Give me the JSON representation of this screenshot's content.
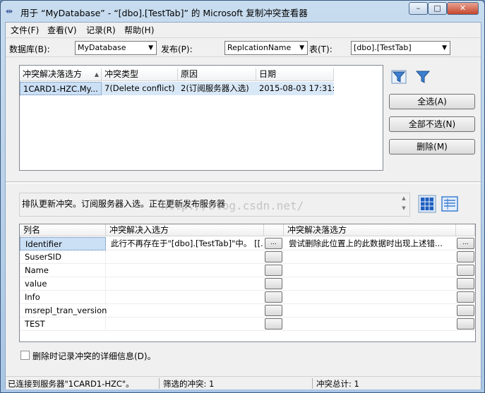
{
  "window": {
    "title": "用于 “MyDatabase” - “[dbo].[TestTab]” 的 Microsoft 复制冲突查看器",
    "minimize": "–",
    "maximize": "□",
    "close": "✕"
  },
  "menu": [
    "文件(F)",
    "查看(V)",
    "记录(R)",
    "帮助(H)"
  ],
  "toolbar": {
    "database_label": "数据库(B):",
    "database_value": "MyDatabase",
    "publication_label": "发布(P):",
    "publication_value": "ReplcationName",
    "table_label": "表(T):",
    "table_value": "[dbo].[TestTab]"
  },
  "conflict_list": {
    "columns": [
      "冲突解决落选方",
      "冲突类型",
      "原因",
      "日期"
    ],
    "rows": [
      [
        "1CARD1-HZC.My...",
        "7(Delete conflict)",
        "2(订阅服务器入选)",
        "2015-08-03 17:31:..."
      ]
    ]
  },
  "actions": {
    "select_all": "全选(A)",
    "select_none": "全部不选(N)",
    "delete": "删除(M)"
  },
  "message": "排队更新冲突。订阅服务器入选。正在更新发布服务器",
  "watermark": "http://blog.csdn.net/",
  "detail_grid": {
    "columns": [
      "列名",
      "冲突解决入选方",
      "冲突解决落选方"
    ],
    "rows": [
      {
        "name": "Identifier",
        "winner": "此行不再存在于\"[dbo].[TestTab]\"中。 [[...",
        "loser": "尝试删除此位置上的此数据时出现上述错..."
      },
      {
        "name": "SuserSID",
        "winner": "",
        "loser": ""
      },
      {
        "name": "Name",
        "winner": "",
        "loser": ""
      },
      {
        "name": "value",
        "winner": "",
        "loser": ""
      },
      {
        "name": "Info",
        "winner": "",
        "loser": ""
      },
      {
        "name": "msrepl_tran_version",
        "winner": "",
        "loser": ""
      },
      {
        "name": "TEST",
        "winner": "",
        "loser": ""
      }
    ],
    "ellipsis": "..."
  },
  "log_details_label": "删除时记录冲突的详细信息(D)。",
  "log_details_checked": false,
  "status": {
    "connection": "已连接到服务器\"1CARD1-HZC\"。",
    "filtered": "筛选的冲突: 1",
    "total": "冲突总计: 1"
  },
  "colors": {
    "selection": "#cbdff5",
    "filter_icon": "#3b7fd1"
  },
  "icons": [
    "app-icon",
    "filter-icon",
    "filter-clear-icon",
    "grid-view-icon",
    "form-view-icon"
  ]
}
